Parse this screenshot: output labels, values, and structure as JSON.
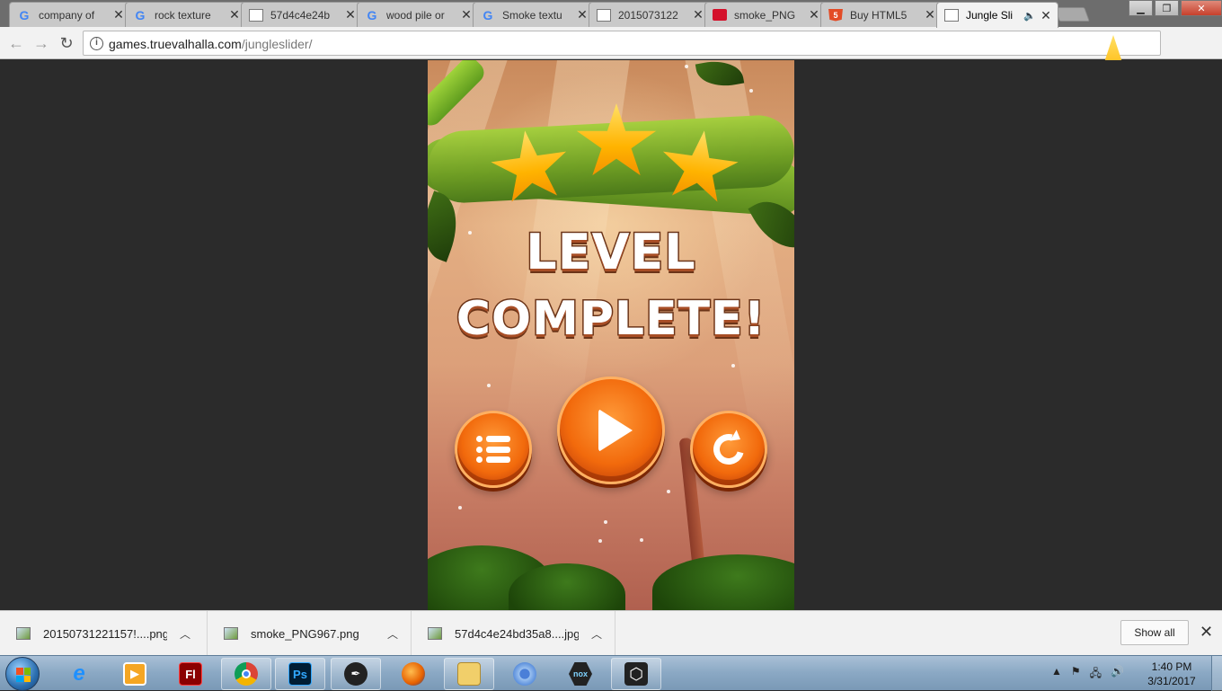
{
  "browser": {
    "tabs": [
      {
        "title": "company of",
        "icon": "google-icon"
      },
      {
        "title": "rock texture",
        "icon": "google-icon"
      },
      {
        "title": "57d4c4e24b",
        "icon": "document-icon"
      },
      {
        "title": "wood pile or",
        "icon": "google-icon"
      },
      {
        "title": "Smoke textu",
        "icon": "google-icon"
      },
      {
        "title": "2015073122",
        "icon": "document-icon"
      },
      {
        "title": "smoke_PNG",
        "icon": "red-image-icon"
      },
      {
        "title": "Buy HTML5",
        "icon": "html5-icon"
      },
      {
        "title": "Jungle Sli",
        "icon": "document-icon",
        "active": true,
        "audio": true
      }
    ],
    "url_host": "games.truevalhalla.com",
    "url_path": "/jungleslider/"
  },
  "game": {
    "stars_earned": 3,
    "title_line1": "LEVEL",
    "title_line2": "COMPLETE!",
    "buttons": [
      "menu-icon",
      "play-icon",
      "replay-icon"
    ],
    "accent_color": "#f26a0c",
    "star_color": "#ffb300"
  },
  "downloads": {
    "items": [
      {
        "name": "20150731221157!....png"
      },
      {
        "name": "smoke_PNG967.png"
      },
      {
        "name": "57d4c4e24bd35a8....jpg"
      }
    ],
    "show_all": "Show all"
  },
  "taskbar": {
    "apps": [
      "internet-explorer-icon",
      "media-player-icon",
      "flash-icon",
      "chrome-icon",
      "photoshop-icon",
      "inkscape-icon",
      "firefox-icon",
      "file-explorer-icon",
      "chromium-icon",
      "nox-icon",
      "unity-icon"
    ],
    "photoshop_label": "Ps",
    "flash_label": "Fl",
    "nox_label": "nox",
    "time": "1:40 PM",
    "date": "3/31/2017"
  }
}
